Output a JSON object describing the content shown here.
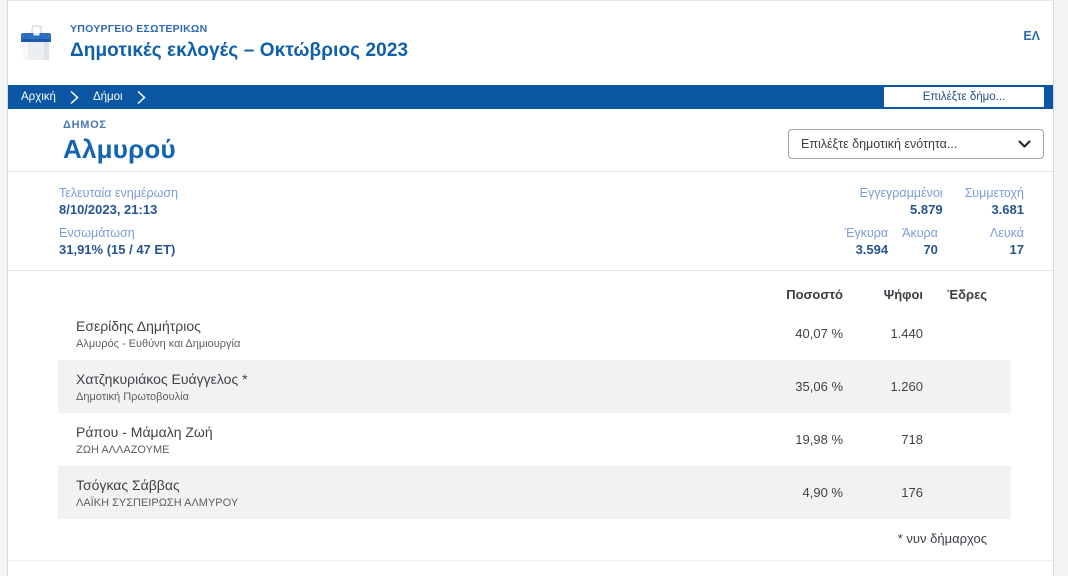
{
  "header": {
    "ministry": "ΥΠΟΥΡΓΕΙΟ ΕΣΩΤΕΡΙΚΩΝ",
    "title": "Δημοτικές εκλογές – Οκτώβριος 2023",
    "language": "ΕΛ"
  },
  "breadcrumb": {
    "items": [
      {
        "label": "Αρχική"
      },
      {
        "label": "Δήμοι"
      }
    ],
    "municipality_select_placeholder": "Επιλέξτε δήμο..."
  },
  "municipality": {
    "label": "ΔΗΜΟΣ",
    "name": "Αλμυρού",
    "unit_select_placeholder": "Επιλέξτε δημοτική ενότητα..."
  },
  "stats": {
    "last_update": {
      "label": "Τελευταία ενημέρωση",
      "value": "8/10/2023, 21:13"
    },
    "incorporation": {
      "label": "Ενσωμάτωση",
      "value": "31,91% (15 / 47 ΕΤ)"
    },
    "registered": {
      "label": "Εγγεγραμμένοι",
      "value": "5.879"
    },
    "turnout": {
      "label": "Συμμετοχή",
      "value": "3.681"
    },
    "valid": {
      "label": "Έγκυρα",
      "value": "3.594"
    },
    "invalid": {
      "label": "Άκυρα",
      "value": "70"
    },
    "blank": {
      "label": "Λευκά",
      "value": "17"
    }
  },
  "results": {
    "columns": {
      "percent": "Ποσοστό",
      "votes": "Ψήφοι",
      "seats": "Έδρες"
    },
    "rows": [
      {
        "candidate": "Εσερίδης Δημήτριος",
        "party": "Αλμυρός - Ευθύνη και Δημιουργία",
        "percent": "40,07 %",
        "votes": "1.440",
        "seats": ""
      },
      {
        "candidate": "Χατζηκυριάκος Ευάγγελος *",
        "party": "Δημοτική Πρωτοβουλία",
        "percent": "35,06 %",
        "votes": "1.260",
        "seats": ""
      },
      {
        "candidate": "Ράπου - Μάμαλη Ζωή",
        "party": "ΖΩΗ ΑΛΛΑΖΟΥΜΕ",
        "percent": "19,98 %",
        "votes": "718",
        "seats": ""
      },
      {
        "candidate": "Τσόγκας Σάββας",
        "party": "ΛΑΪΚΗ ΣΥΣΠΕΙΡΩΣΗ ΑΛΜΥΡΟΥ",
        "percent": "4,90 %",
        "votes": "176",
        "seats": ""
      }
    ],
    "footnote": "* νυν δήμαρχος"
  },
  "icons": {
    "logo": "ballot-box-icon",
    "breadcrumb_separator": "chevron-right-icon",
    "dropdown": "chevron-down-icon"
  },
  "colors": {
    "brand_blue": "#0b57a4",
    "title_blue": "#0f60ab",
    "label_light_blue": "#7b9dd3",
    "value_blue": "#27548f",
    "row_gray": "#f2f2f2"
  }
}
